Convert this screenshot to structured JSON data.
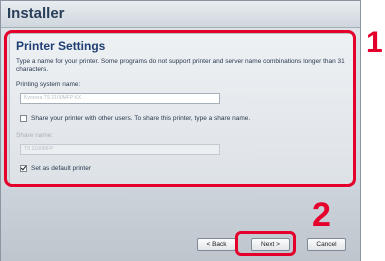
{
  "window": {
    "title": "Installer"
  },
  "panel": {
    "heading": "Printer Settings",
    "description": "Type a name for your printer. Some programs do not support printer and server name combinations longer than 31 characters.",
    "system_name_label": "Printing system name:",
    "system_name_value": "Kyocera TS 2100MFP KX",
    "share_checkbox_label": "Share your printer with other users. To share this printer, type a share name.",
    "share_checked": false,
    "share_name_label": "Share name:",
    "share_name_value": "TS 2100MFP",
    "default_checkbox_label": "Set as default printer",
    "default_checked": true
  },
  "buttons": {
    "back": "< Back",
    "next": "Next >",
    "cancel": "Cancel"
  },
  "callouts": {
    "step1": "1",
    "step2": "2"
  },
  "colors": {
    "highlight": "#e4002b",
    "heading": "#1e3e73"
  }
}
